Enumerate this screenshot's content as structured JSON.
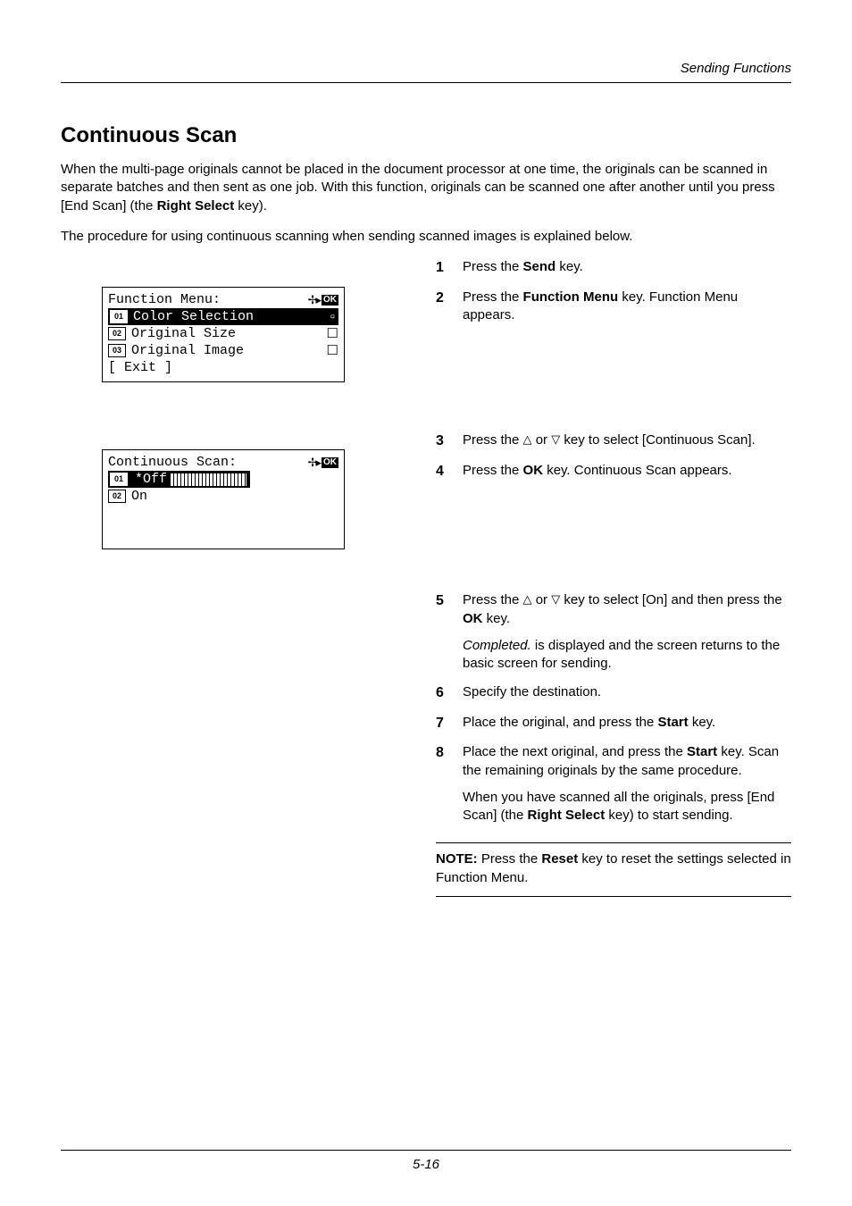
{
  "header": {
    "title": "Sending Functions"
  },
  "section": {
    "title": "Continuous Scan"
  },
  "intro": {
    "p1_a": "When the multi-page originals cannot be placed in the document processor at one time, the originals can be scanned in separate batches and then sent as one job. With this function, originals can be scanned one after another until you press [End Scan] (the ",
    "p1_b": "Right Select",
    "p1_c": " key).",
    "p2": "The procedure for using continuous scanning when sending scanned images is explained below."
  },
  "lcd1": {
    "title": "Function Menu:",
    "ok": "OK",
    "items": [
      {
        "num": "01",
        "label": "Color Selection",
        "selected": true
      },
      {
        "num": "02",
        "label": "Original Size",
        "selected": false
      },
      {
        "num": "03",
        "label": "Original Image",
        "selected": false
      }
    ],
    "exit": "[  Exit  ]"
  },
  "lcd2": {
    "title": "Continuous Scan:",
    "ok": "OK",
    "items": [
      {
        "num": "01",
        "label": "*Off",
        "selected": true
      },
      {
        "num": "02",
        "label": "On",
        "selected": false
      }
    ]
  },
  "steps": {
    "s1": {
      "n": "1",
      "a": "Press the ",
      "b": "Send",
      "c": " key."
    },
    "s2": {
      "n": "2",
      "a": "Press the ",
      "b": "Function Menu",
      "c": " key. Function Menu appears."
    },
    "s3": {
      "n": "3",
      "a": "Press the ",
      "b": " or ",
      "c": " key to select [Continuous Scan]."
    },
    "s4": {
      "n": "4",
      "a": "Press the ",
      "b": "OK",
      "c": " key. Continuous Scan appears."
    },
    "s5": {
      "n": "5",
      "a": "Press the ",
      "b": " or ",
      "c": " key to select [On] and then press the ",
      "d": "OK",
      "e": " key.",
      "comp_a": "Completed.",
      "comp_b": " is displayed and the screen returns to the basic screen for sending."
    },
    "s6": {
      "n": "6",
      "a": "Specify the destination."
    },
    "s7": {
      "n": "7",
      "a": "Place the original, and press the ",
      "b": "Start",
      "c": " key."
    },
    "s8": {
      "n": "8",
      "a": "Place the next original, and press the ",
      "b": "Start",
      "c": " key. Scan the remaining originals by the same procedure.",
      "d": "When you have scanned all the originals, press [End Scan] (the ",
      "e": "Right Select",
      "f": " key) to start sending."
    }
  },
  "note": {
    "label": "NOTE:",
    "a": " Press the ",
    "b": "Reset",
    "c": " key to reset the settings selected in Function Menu."
  },
  "footer": {
    "page": "5-16"
  }
}
